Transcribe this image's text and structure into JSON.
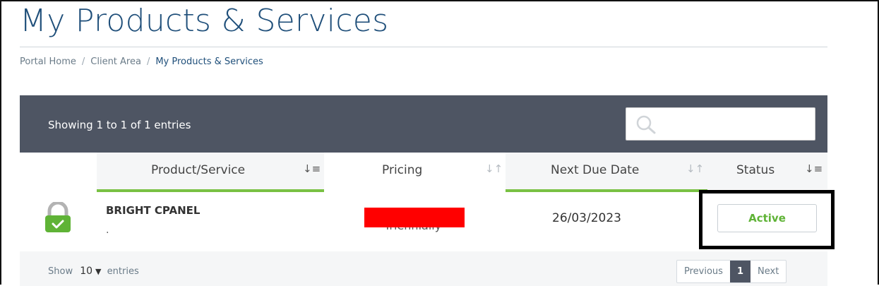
{
  "page": {
    "title": "My Products & Services",
    "breadcrumb": [
      "Portal Home",
      "Client Area",
      "My Products & Services"
    ]
  },
  "toolbar": {
    "showing_text": "Showing 1 to 1 of 1 entries",
    "search_placeholder": "",
    "search_icon": "search-icon"
  },
  "table": {
    "columns": [
      "Product/Service",
      "Pricing",
      "Next Due Date",
      "Status"
    ],
    "rows": [
      {
        "icon": "lock-check-icon",
        "product_name": "BRIGHT CPANEL",
        "product_domain": ".",
        "pricing_visible": "Triennially",
        "next_due_date": "26/03/2023",
        "status": "Active"
      }
    ]
  },
  "footer": {
    "show_label": "Show",
    "entries_value": "10",
    "entries_label": "entries",
    "pagination": {
      "previous": "Previous",
      "current": "1",
      "next": "Next"
    }
  },
  "colors": {
    "title": "#1f4f7a",
    "toolbar_bg": "#4e5563",
    "accent_green": "#79c143",
    "status_active": "#5fb336",
    "redaction": "#ff0000"
  }
}
